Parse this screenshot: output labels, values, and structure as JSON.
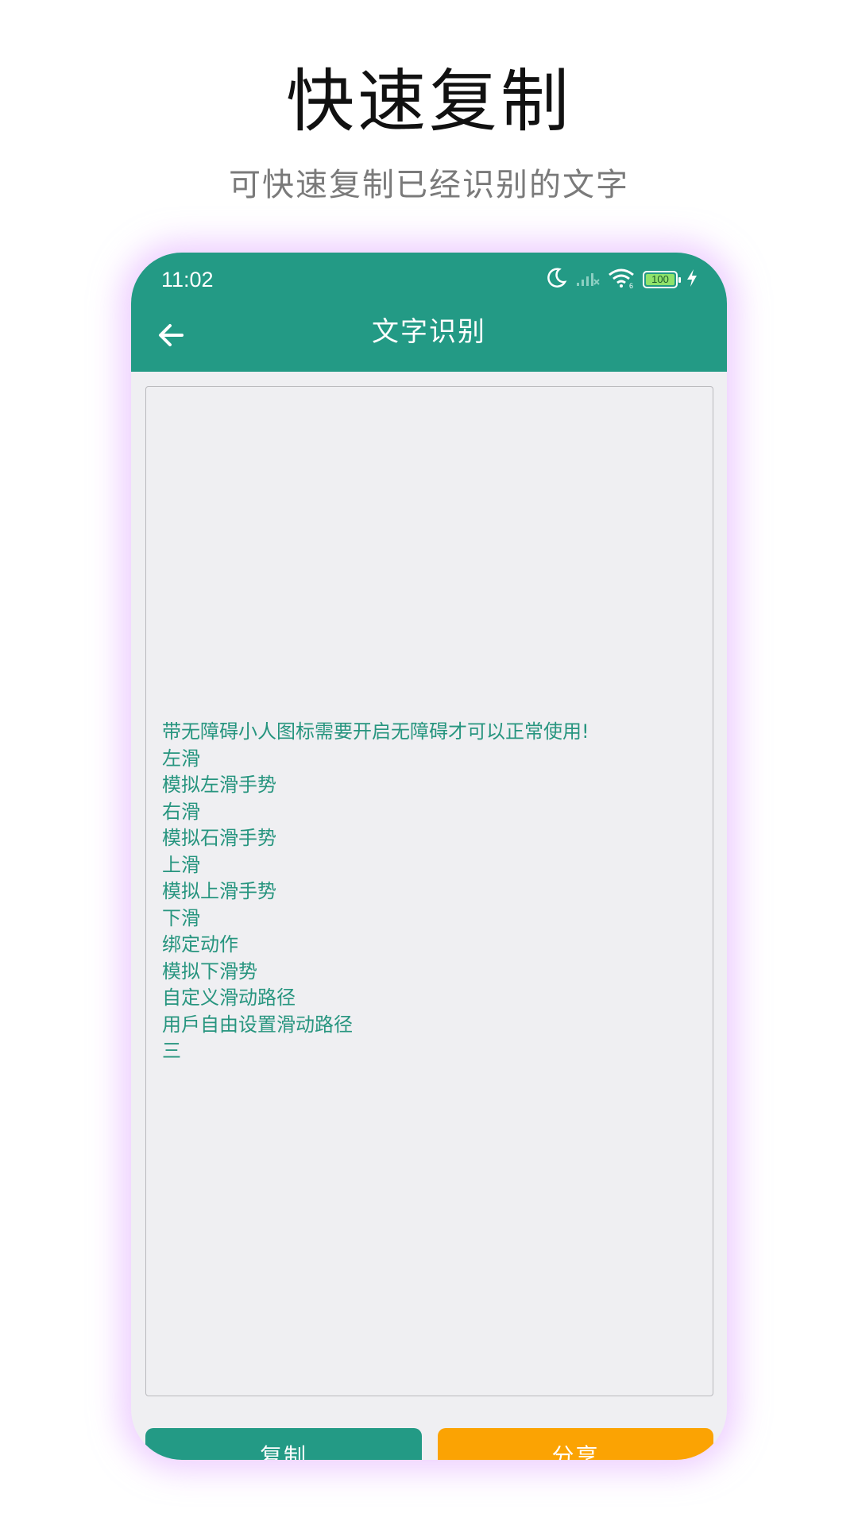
{
  "promo": {
    "title": "快速复制",
    "subtitle": "可快速复制已经识别的文字"
  },
  "status_bar": {
    "time": "11:02",
    "icons": [
      "moon-icon",
      "signal-icon",
      "wifi-icon",
      "battery-icon",
      "charging-icon"
    ],
    "battery_level": "100"
  },
  "app_bar": {
    "back_icon": "arrow-left-icon",
    "title": "文字识别",
    "color": "#239a85"
  },
  "result": {
    "lines": [
      "带无障碍小人图标需要开启无障碍才可以正常使用!",
      "左滑",
      "模拟左滑手势",
      "右滑",
      "模拟石滑手势",
      "上滑",
      "模拟上滑手势",
      "下滑",
      "绑定动作",
      "模拟下滑势",
      "自定义滑动路径",
      "用戶自由设置滑动路径",
      "三"
    ],
    "text_color": "#27957f"
  },
  "actions": {
    "copy_label": "复制",
    "share_label": "分享",
    "copy_color": "#239a85",
    "share_color": "#fba303"
  }
}
